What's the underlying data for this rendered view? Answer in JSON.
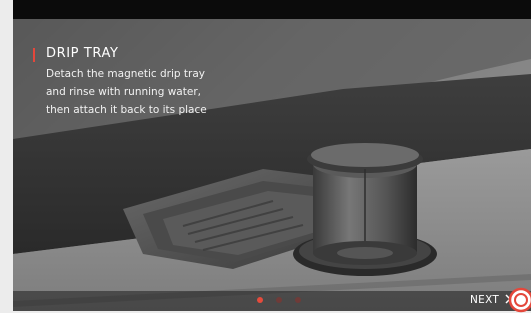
{
  "slide": {
    "title": "DRIP TRAY",
    "body_lines": [
      "Detach the magnetic drip tray",
      "and rinse with running water,",
      "then attach it back to its place"
    ]
  },
  "pagination": {
    "total": 3,
    "current": 1
  },
  "nav": {
    "next_label": "NEXT",
    "next_icon": "chevron-right-icon"
  },
  "colors": {
    "accent": "#e4473b",
    "dot_active": "#e64b3c",
    "dot_inactive": "#6f3b38",
    "top_bar": "#0b0b0b"
  },
  "logo": {
    "icon": "brand-logo-icon"
  }
}
